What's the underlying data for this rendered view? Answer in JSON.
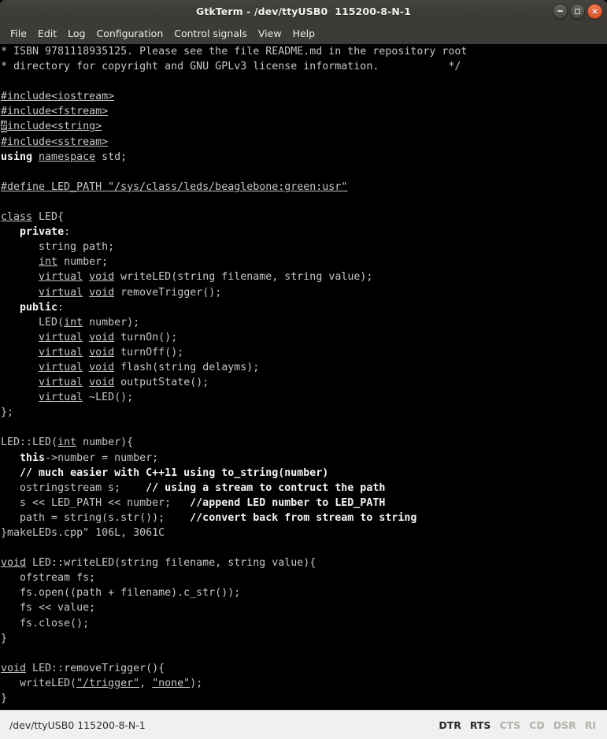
{
  "window": {
    "title": "GtkTerm - /dev/ttyUSB0  115200-8-N-1",
    "controls": {
      "minimize_label": "–",
      "maximize_label": "□",
      "close_label": "×"
    },
    "colors": {
      "titlebar_bg": "#3c3b37",
      "menubar_bg": "#3c3b37",
      "terminal_bg": "#000000",
      "terminal_fg": "#c6c6c6",
      "terminal_fg_bold": "#f4f4f4",
      "cursor_bg": "#9a9a9a",
      "statusbar_bg": "#f1f0ee",
      "close_button": "#e0522a",
      "signal_on": "#2b2b2b",
      "signal_off": "#b3b1ae"
    }
  },
  "menubar": {
    "items": [
      {
        "label": "File"
      },
      {
        "label": "Edit"
      },
      {
        "label": "Log"
      },
      {
        "label": "Configuration"
      },
      {
        "label": "Control signals"
      },
      {
        "label": "View"
      },
      {
        "label": "Help"
      }
    ]
  },
  "terminal": {
    "lines": [
      [
        {
          "t": "* ISBN 9781118935125. Please see the file README.md in the repository root"
        }
      ],
      [
        {
          "t": "* directory for copyright and GNU GPLv3 license information.           */"
        }
      ],
      [
        {
          "t": ""
        }
      ],
      [
        {
          "t": "#include<iostream>",
          "s": "u"
        }
      ],
      [
        {
          "t": "#include<fstream>",
          "s": "u"
        }
      ],
      [
        {
          "t": "#",
          "s": "cursor"
        },
        {
          "t": "include<string>",
          "s": "u"
        }
      ],
      [
        {
          "t": "#include<sstream>",
          "s": "u"
        }
      ],
      [
        {
          "t": "using ",
          "s": "b"
        },
        {
          "t": "namespace",
          "s": "u"
        },
        {
          "t": " std;"
        }
      ],
      [
        {
          "t": ""
        }
      ],
      [
        {
          "t": "#define LED_PATH \"/sys/class/leds/beaglebone:green:usr\"",
          "s": "u"
        }
      ],
      [
        {
          "t": ""
        }
      ],
      [
        {
          "t": "class",
          "s": "u"
        },
        {
          "t": " LED{"
        }
      ],
      [
        {
          "t": "   "
        },
        {
          "t": "private",
          "s": "b"
        },
        {
          "t": ":"
        }
      ],
      [
        {
          "t": "      string path;"
        }
      ],
      [
        {
          "t": "      "
        },
        {
          "t": "int",
          "s": "u"
        },
        {
          "t": " number;"
        }
      ],
      [
        {
          "t": "      "
        },
        {
          "t": "virtual",
          "s": "u"
        },
        {
          "t": " "
        },
        {
          "t": "void",
          "s": "u"
        },
        {
          "t": " writeLED(string filename, string value);"
        }
      ],
      [
        {
          "t": "      "
        },
        {
          "t": "virtual",
          "s": "u"
        },
        {
          "t": " "
        },
        {
          "t": "void",
          "s": "u"
        },
        {
          "t": " removeTrigger();"
        }
      ],
      [
        {
          "t": "   "
        },
        {
          "t": "public",
          "s": "b"
        },
        {
          "t": ":"
        }
      ],
      [
        {
          "t": "      LED("
        },
        {
          "t": "int",
          "s": "u"
        },
        {
          "t": " number);"
        }
      ],
      [
        {
          "t": "      "
        },
        {
          "t": "virtual",
          "s": "u"
        },
        {
          "t": " "
        },
        {
          "t": "void",
          "s": "u"
        },
        {
          "t": " turnOn();"
        }
      ],
      [
        {
          "t": "      "
        },
        {
          "t": "virtual",
          "s": "u"
        },
        {
          "t": " "
        },
        {
          "t": "void",
          "s": "u"
        },
        {
          "t": " turnOff();"
        }
      ],
      [
        {
          "t": "      "
        },
        {
          "t": "virtual",
          "s": "u"
        },
        {
          "t": " "
        },
        {
          "t": "void",
          "s": "u"
        },
        {
          "t": " flash(string delayms);"
        }
      ],
      [
        {
          "t": "      "
        },
        {
          "t": "virtual",
          "s": "u"
        },
        {
          "t": " "
        },
        {
          "t": "void",
          "s": "u"
        },
        {
          "t": " outputState();"
        }
      ],
      [
        {
          "t": "      "
        },
        {
          "t": "virtual",
          "s": "u"
        },
        {
          "t": " ~LED();"
        }
      ],
      [
        {
          "t": "};"
        }
      ],
      [
        {
          "t": ""
        }
      ],
      [
        {
          "t": "LED::LED("
        },
        {
          "t": "int",
          "s": "u"
        },
        {
          "t": " number){"
        }
      ],
      [
        {
          "t": "   "
        },
        {
          "t": "this",
          "s": "b"
        },
        {
          "t": "->number = number;"
        }
      ],
      [
        {
          "t": "   "
        },
        {
          "t": "// much easier with C++11 using to_string(number)",
          "s": "b"
        }
      ],
      [
        {
          "t": "   ostringstream s;    "
        },
        {
          "t": "// using a stream to contruct the path",
          "s": "b"
        }
      ],
      [
        {
          "t": "   s << LED_PATH << number;   "
        },
        {
          "t": "//append LED number to LED_PATH",
          "s": "b"
        }
      ],
      [
        {
          "t": "   path = string(s.str());    "
        },
        {
          "t": "//convert back from stream to string",
          "s": "b"
        }
      ],
      [
        {
          "t": "}makeLEDs.cpp\" 106L, 3061C"
        }
      ],
      [
        {
          "t": ""
        }
      ],
      [
        {
          "t": "void",
          "s": "u"
        },
        {
          "t": " LED::writeLED(string filename, string value){"
        }
      ],
      [
        {
          "t": "   ofstream fs;"
        }
      ],
      [
        {
          "t": "   fs.open((path + filename).c_str());"
        }
      ],
      [
        {
          "t": "   fs << value;"
        }
      ],
      [
        {
          "t": "   fs.close();"
        }
      ],
      [
        {
          "t": "}"
        }
      ],
      [
        {
          "t": ""
        }
      ],
      [
        {
          "t": "void",
          "s": "u"
        },
        {
          "t": " LED::removeTrigger(){"
        }
      ],
      [
        {
          "t": "   writeLED("
        },
        {
          "t": "\"/trigger\"",
          "s": "u"
        },
        {
          "t": ", "
        },
        {
          "t": "\"none\"",
          "s": "u"
        },
        {
          "t": ");"
        }
      ],
      [
        {
          "t": "}"
        }
      ]
    ]
  },
  "statusbar": {
    "port_info": "/dev/ttyUSB0 115200-8-N-1",
    "signals": [
      {
        "label": "DTR",
        "active": true
      },
      {
        "label": "RTS",
        "active": true
      },
      {
        "label": "CTS",
        "active": false
      },
      {
        "label": "CD",
        "active": false
      },
      {
        "label": "DSR",
        "active": false
      },
      {
        "label": "RI",
        "active": false
      }
    ]
  }
}
